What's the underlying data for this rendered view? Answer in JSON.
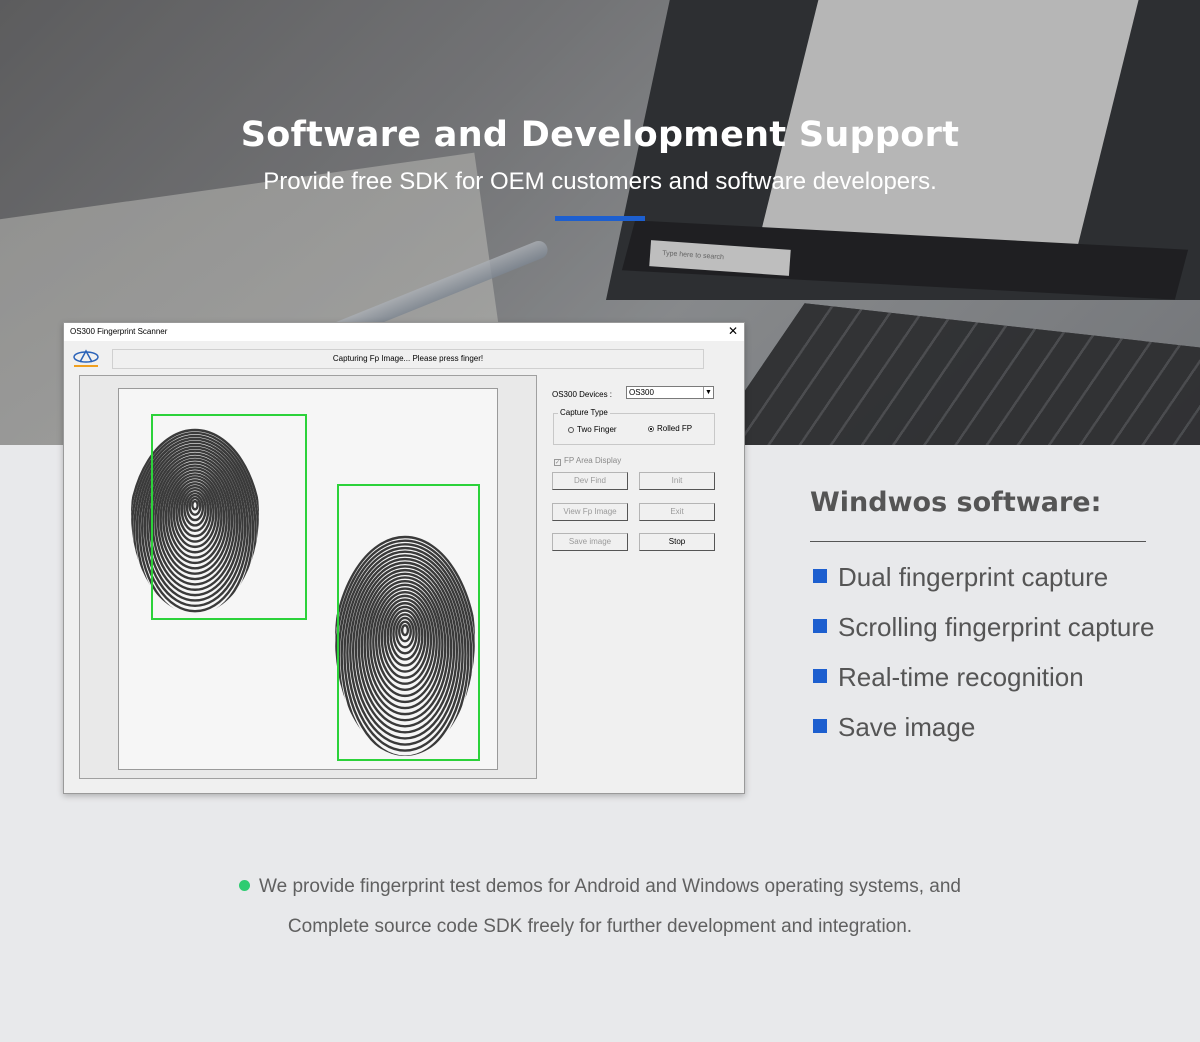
{
  "hero": {
    "title": "Software and Development Support",
    "subtitle": "Provide free SDK for OEM customers and software developers.",
    "taskbar_search": "Type here to search",
    "accent_color": "#1d5fcf"
  },
  "window": {
    "title": "OS300 Fingerprint Scanner",
    "close_icon": "close-icon",
    "status": "Capturing Fp Image... Please press finger!",
    "devices_label": "OS300 Devices :",
    "device_selected": "OS300",
    "capture_type_label": "Capture Type",
    "capture_options": [
      {
        "label": "Two Finger",
        "selected": false
      },
      {
        "label": "Rolled FP",
        "selected": true
      }
    ],
    "fp_area_display": {
      "label": "FP Area Display",
      "checked": true
    },
    "buttons": {
      "dev_find": "Dev Find",
      "init": "Init",
      "view_fp_image": "View Fp Image",
      "exit": "Exit",
      "save_image": "Save image",
      "stop": "Stop"
    }
  },
  "features": {
    "title": "Windwos software:",
    "items": [
      "Dual fingerprint capture",
      "Scrolling fingerprint capture",
      "Real-time recognition",
      "Save image"
    ],
    "bullet_color": "#1d5fcf"
  },
  "note": {
    "line1": "We provide fingerprint test demos for Android and Windows operating systems, and",
    "line2": "Complete source code SDK freely for further development and integration.",
    "bullet_color": "#2ecc71"
  }
}
